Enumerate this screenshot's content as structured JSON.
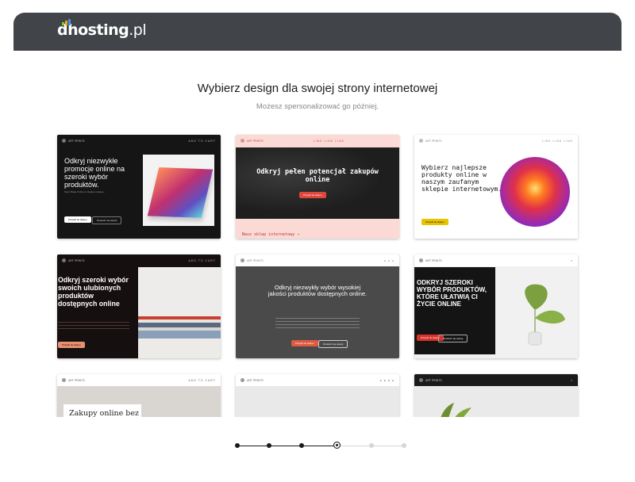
{
  "brand": {
    "name": "dhosting",
    "tld": ".pl",
    "bar_colors": [
      "#7ed321",
      "#f5a623",
      "#4a90e2"
    ]
  },
  "page": {
    "title": "Wybierz design dla swojej strony internetowej",
    "subtitle": "Możesz spersonalizować go później."
  },
  "templates": [
    {
      "logo": "ART PRINTS",
      "nav": "ADD TO CART",
      "headline": "Odkryj niezwykłe promocje online na szeroki wybór produktów.",
      "text": "Nasz Sklep Online to idealne miejsce...",
      "btn1": "Przejdź do sklepu",
      "btn2": "Dowiedz się więcej"
    },
    {
      "logo": "ART PRINTS",
      "nav": "LINK  LINK  LINK",
      "headline": "Odkryj pełen potencjał zakupów online",
      "btn1": "Przejdź do sklepu",
      "footer": "Nasz sklep internetowy →"
    },
    {
      "logo": "ART PRINTS",
      "nav": "LINK  LINK  LINK",
      "headline": "Wybierz najlepsze produkty online w naszym zaufanym sklepie internetowym.",
      "btn1": "Przejdź do sklepu"
    },
    {
      "logo": "ART PRINTS",
      "nav": "ADD TO CART",
      "headline": "Odkryj szeroki wybór swoich ulubionych produktów dostępnych online",
      "btn1": "Przejdź do sklepu"
    },
    {
      "logo": "ART PRINTS",
      "nav": "● ● ●",
      "headline": "Odkryj niezwykły wybór wysokiej jakości produktów dostępnych online.",
      "btn1": "Przejdź do sklepu",
      "btn2": "Dowiedz się więcej"
    },
    {
      "logo": "ART PRINTS",
      "nav": "≡",
      "headline": "ODKRYJ SZEROKI WYBÓR PRODUKTÓW, KTÓRE UŁATWIĄ CI ŻYCIE ONLINE",
      "btn1": "Przejdź do sklepu",
      "btn2": "Dowiedz się więcej"
    },
    {
      "logo": "ART PRINTS",
      "nav": "ADD TO CART",
      "headline": "Zakupy online bez granic"
    },
    {
      "logo": "ART PRINTS",
      "nav": "● ● ● ●"
    },
    {
      "logo": "ART PRINTS",
      "nav": "≡"
    }
  ],
  "stepper": {
    "total_steps": 6,
    "current_step": 4
  },
  "colors": {
    "header": "#414549",
    "step_active": "#1a1a1a",
    "step_inactive": "#d6d6d6"
  }
}
